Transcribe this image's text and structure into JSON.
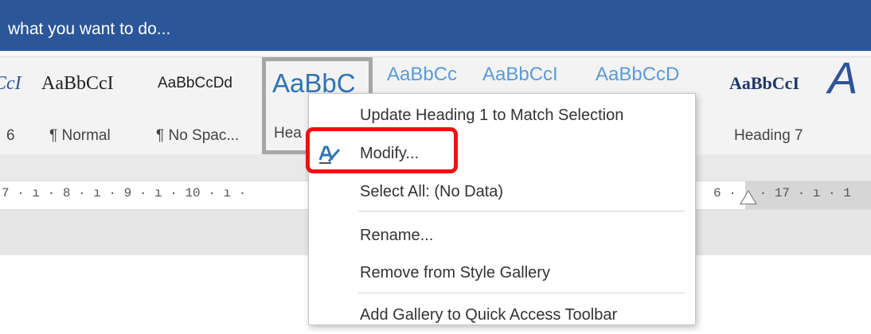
{
  "tell_me": {
    "text": "what you want to do..."
  },
  "ribbon": {
    "styles": [
      {
        "sample": "CcI",
        "name": "6"
      },
      {
        "sample": "AaBbCcI",
        "name": ""
      },
      {
        "sample": "AaBbCcDd",
        "name": "¶ Normal"
      },
      {
        "sample": "",
        "name": "¶ No Spac..."
      },
      {
        "sample": "AaBbC",
        "name": "Hea"
      },
      {
        "sample": "AaBbCc",
        "name": ""
      },
      {
        "sample": "AaBbCcI",
        "name": ""
      },
      {
        "sample": "AaBbCcD",
        "name": ""
      },
      {
        "sample": "AaBbCcI",
        "name": "Heading 7"
      },
      {
        "sample": "A",
        "name": ""
      }
    ]
  },
  "ruler": {
    "left_text": "7 · ı · 8 · ı · 9 · ı · 10 · ı ·",
    "right_text": "6 ·   · 17 · ı · 1"
  },
  "context_menu": {
    "items": [
      {
        "label": "Update Heading 1 to Match Selection"
      },
      {
        "label": "Modify..."
      },
      {
        "label": "Select All: (No Data)"
      },
      {
        "label": "Rename..."
      },
      {
        "label": "Remove from Style Gallery"
      },
      {
        "label": "Add Gallery to Quick Access Toolbar"
      }
    ]
  },
  "colors": {
    "accent": "#2b579a",
    "highlight": "#ee1111"
  }
}
